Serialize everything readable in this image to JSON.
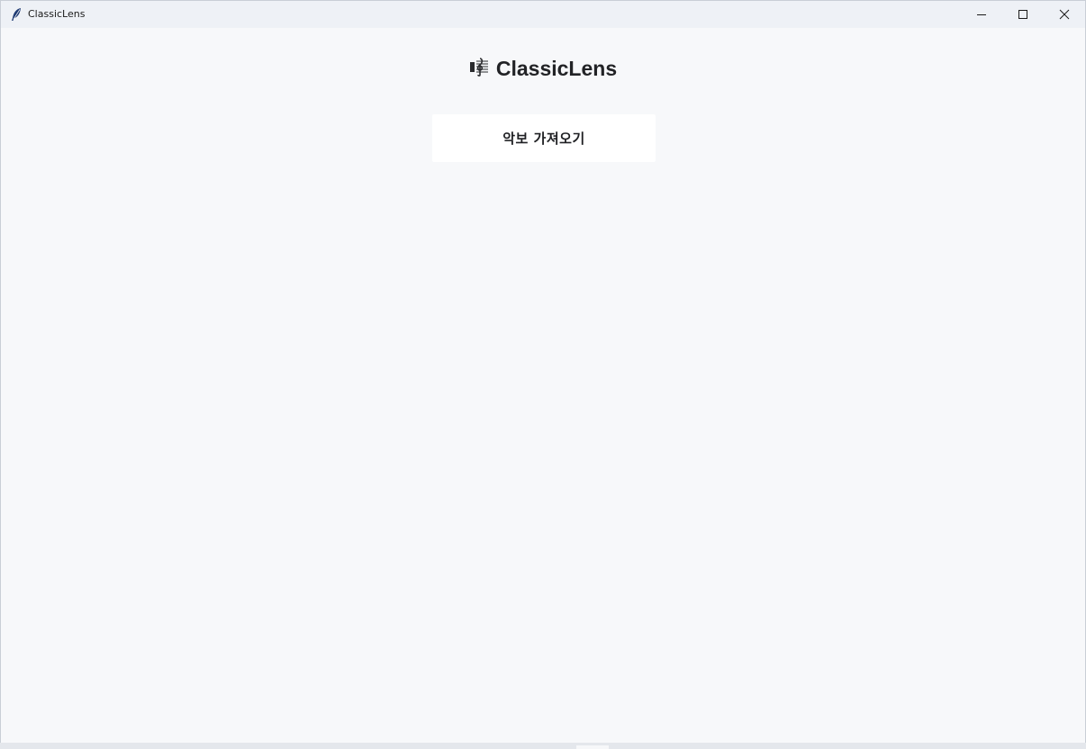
{
  "window": {
    "title": "ClassicLens",
    "app_icon": "feather-icon",
    "controls": {
      "minimize": "minimize-icon",
      "maximize": "maximize-icon",
      "close": "close-icon"
    }
  },
  "header": {
    "icon": "musical-score-icon",
    "title": "ClassicLens"
  },
  "actions": {
    "import_label": "악보 가져오기"
  },
  "colors": {
    "background": "#f7f8fa",
    "titlebar": "#eef1f6",
    "button": "#ffffff",
    "text": "#222326"
  }
}
